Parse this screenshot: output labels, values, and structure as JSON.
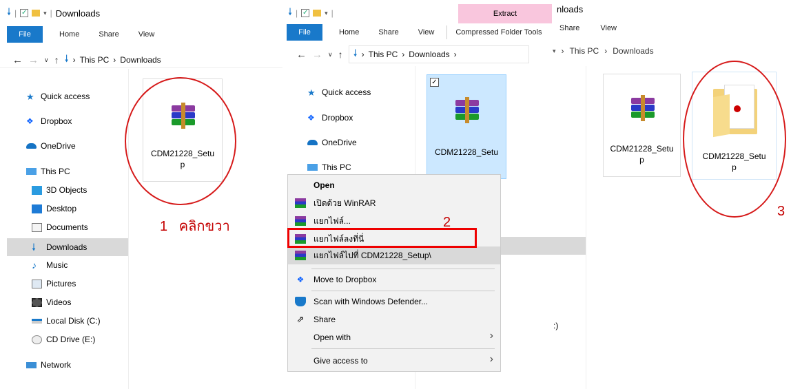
{
  "panel1": {
    "title": "Downloads",
    "tabs": [
      "File",
      "Home",
      "Share",
      "View"
    ],
    "breadcrumb": [
      "This PC",
      "Downloads"
    ],
    "sidebar": [
      {
        "label": "Quick access",
        "icon": "star-icon"
      },
      {
        "label": "Dropbox",
        "icon": "dropbox-icon"
      },
      {
        "label": "OneDrive",
        "icon": "onedrive-icon"
      },
      {
        "label": "This PC",
        "icon": "computer-icon"
      },
      {
        "label": "3D Objects",
        "icon": "cube-icon"
      },
      {
        "label": "Desktop",
        "icon": "desktop-icon"
      },
      {
        "label": "Documents",
        "icon": "document-icon"
      },
      {
        "label": "Downloads",
        "icon": "download-icon",
        "selected": true
      },
      {
        "label": "Music",
        "icon": "music-icon"
      },
      {
        "label": "Pictures",
        "icon": "picture-icon"
      },
      {
        "label": "Videos",
        "icon": "video-icon"
      },
      {
        "label": "Local Disk (C:)",
        "icon": "disk-icon"
      },
      {
        "label": "CD Drive (E:)",
        "icon": "cd-icon"
      },
      {
        "label": "Network",
        "icon": "network-icon"
      }
    ],
    "file_name_line1": "CDM21228_Setu",
    "file_name_line2": "p",
    "annotation": "1   คลิกขวา"
  },
  "panel2": {
    "tabs": [
      "File",
      "Home",
      "Share",
      "View"
    ],
    "extract_tab": "Extract",
    "compressed_tab": "Compressed Folder Tools",
    "breadcrumb": [
      "This PC",
      "Downloads"
    ],
    "sidebar": [
      {
        "label": "Quick access",
        "icon": "star-icon"
      },
      {
        "label": "Dropbox",
        "icon": "dropbox-icon"
      },
      {
        "label": "OneDrive",
        "icon": "onedrive-icon"
      },
      {
        "label": "This PC",
        "icon": "computer-icon"
      }
    ],
    "file_name_line1": "CDM21228_Setu",
    "status_fragment": ":)",
    "context_menu": {
      "open": "Open",
      "open_with_winrar": "เปิดด้วย WinRAR",
      "extract_files": "แยกไฟล์...",
      "extract_here": "แยกไฟล์ลงที่นี่",
      "extract_to": "แยกไฟล์ไปที่ CDM21228_Setup\\",
      "move_to_dropbox": "Move to Dropbox",
      "scan": "Scan with Windows Defender...",
      "share": "Share",
      "open_with": "Open with",
      "give_access": "Give access to"
    },
    "annotation": "2"
  },
  "panel3": {
    "title_fragment": "nloads",
    "tabs": [
      "Share",
      "View"
    ],
    "breadcrumb": [
      "This PC",
      "Downloads"
    ],
    "file1_line1": "CDM21228_Setu",
    "file1_line2": "p",
    "file2_line1": "CDM21228_Setu",
    "file2_line2": "p",
    "annotation": "3"
  },
  "colors": {
    "accent": "#1979ca",
    "annotation_red": "#d61a1a",
    "extract_tab": "#f9c6dd",
    "selection": "#cce8ff"
  }
}
